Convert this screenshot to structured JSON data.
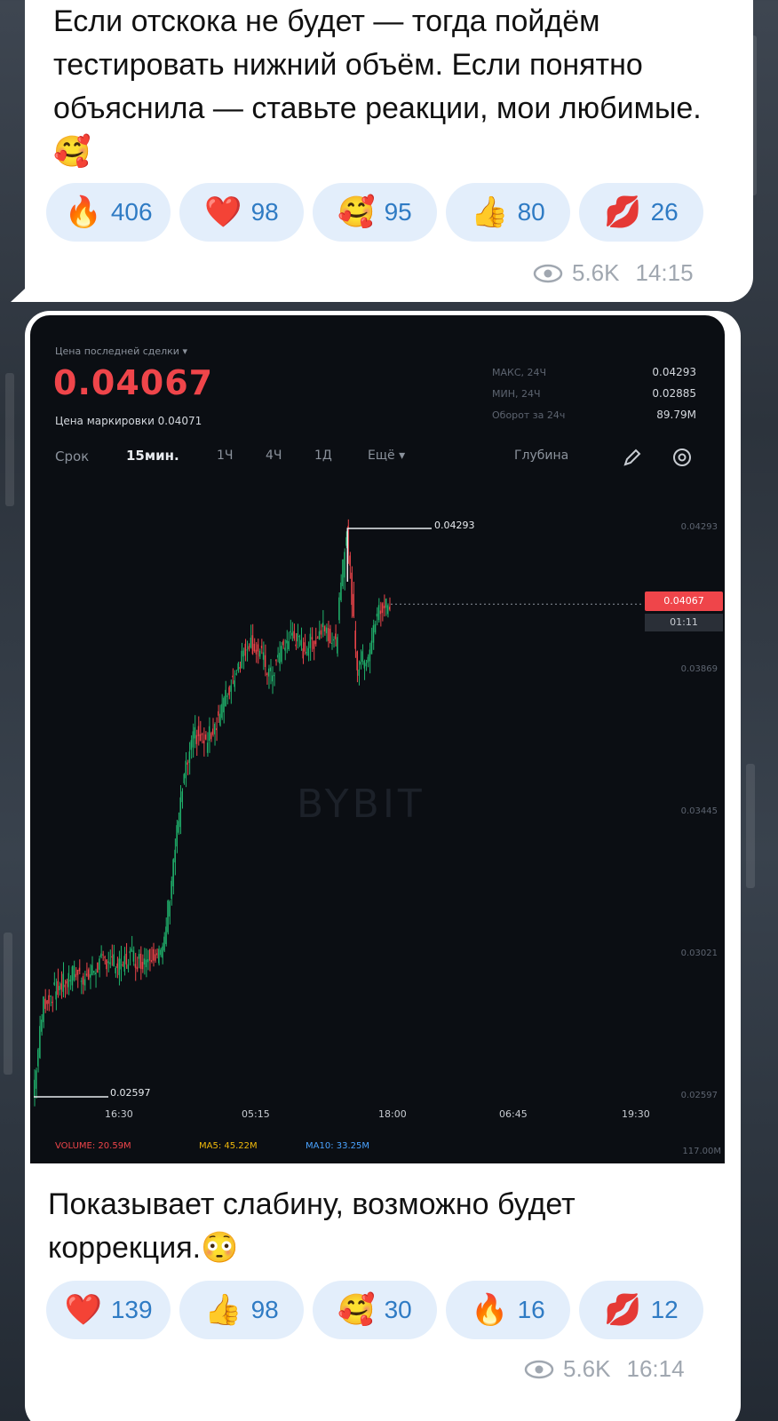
{
  "message1": {
    "text": "Если отскока не будет — тогда пойдём тестировать нижний объём. Если понятно объяснила — ставьте реакции, мои любимые.",
    "emoji": "🥰",
    "reactions": [
      {
        "emoji": "🔥",
        "icon": "fire-icon",
        "count": "406"
      },
      {
        "emoji": "❤️",
        "icon": "heart-icon",
        "count": "98"
      },
      {
        "emoji": "🥰",
        "icon": "smiling-hearts-icon",
        "count": "95"
      },
      {
        "emoji": "👍",
        "icon": "thumbs-up-icon",
        "count": "80"
      },
      {
        "emoji": "💋",
        "icon": "kiss-icon",
        "count": "26"
      }
    ],
    "views": "5.6K",
    "time": "14:15"
  },
  "chart": {
    "last_price_label": "Цена последней сделки ▾",
    "last_price": "0.04067",
    "mark_price_label": "Цена маркировки 0.04071",
    "stats": [
      {
        "label": "МАКС, 24Ч",
        "value": "0.04293"
      },
      {
        "label": "МИН, 24Ч",
        "value": "0.02885"
      },
      {
        "label": "Оборот за 24ч",
        "value": "89.79M"
      }
    ],
    "period_label": "Срок",
    "periods": [
      "15мин.",
      "1Ч",
      "4Ч",
      "1Д",
      "Ещё ▾"
    ],
    "depth_label": "Глубина",
    "watermark": "BYBIT",
    "high_marker": "0.04293",
    "low_marker": "0.02597",
    "current_price_tag": "0.04067",
    "countdown": "01:11",
    "volume_axis_label": "117.00M",
    "volume_line": {
      "volume": "VOLUME: 20.59M",
      "ma5": "MA5: 45.22M",
      "ma10": "MA10: 33.25M"
    },
    "colors": {
      "up": "#20b26c",
      "down": "#ef454a",
      "bg": "#0b0e13",
      "price_tag": "#ef454a"
    }
  },
  "chart_data": {
    "type": "candlestick",
    "x_ticks": [
      "16:30",
      "05:15",
      "18:00",
      "06:45",
      "19:30"
    ],
    "y_ticks": [
      "0.04293",
      "0.03869",
      "0.03445",
      "0.03021",
      "0.02597"
    ],
    "ylim": [
      0.02597,
      0.04293
    ],
    "high": 0.04293,
    "low": 0.02597,
    "last": 0.04067,
    "trend_points": [
      0.02597,
      0.0288,
      0.0291,
      0.0294,
      0.0297,
      0.0295,
      0.0299,
      0.0301,
      0.0298,
      0.0302,
      0.03,
      0.0303,
      0.0302,
      0.033,
      0.0355,
      0.0368,
      0.0365,
      0.0372,
      0.038,
      0.0389,
      0.0396,
      0.0392,
      0.0385,
      0.0393,
      0.0398,
      0.0393,
      0.0396,
      0.0401,
      0.0394,
      0.04293,
      0.0388,
      0.0392,
      0.0405,
      0.04067
    ]
  },
  "message2": {
    "text": "Показывает слабину, возможно будет коррекция.",
    "emoji": "😳",
    "reactions": [
      {
        "emoji": "❤️",
        "icon": "heart-icon",
        "count": "139"
      },
      {
        "emoji": "👍",
        "icon": "thumbs-up-icon",
        "count": "98"
      },
      {
        "emoji": "🥰",
        "icon": "smiling-hearts-icon",
        "count": "30"
      },
      {
        "emoji": "🔥",
        "icon": "fire-icon",
        "count": "16"
      },
      {
        "emoji": "💋",
        "icon": "kiss-icon",
        "count": "12"
      }
    ],
    "views": "5.6K",
    "time": "16:14"
  }
}
